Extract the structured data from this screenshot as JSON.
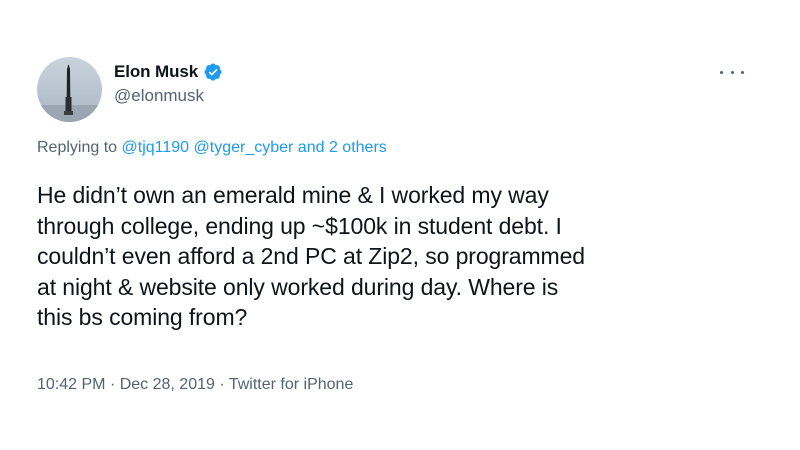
{
  "tweet": {
    "author": {
      "display_name": "Elon Musk",
      "handle": "@elonmusk",
      "avatar_icon": "rocket-avatar",
      "verified_icon": "verified-badge-icon"
    },
    "more_icon": "more-horizontal-icon",
    "replying_to": {
      "prefix": "Replying to",
      "users": [
        "@tjq1190",
        "@tyger_cyber"
      ],
      "and_text": "and",
      "others_text": "2 others"
    },
    "text": "He didn’t own an emerald mine & I worked my way\nthrough college, ending up ~$100k in student debt. I\ncouldn’t even afford a 2nd PC at Zip2, so programmed\nat night & website only worked during day. Where is\nthis bs coming from?",
    "meta": {
      "time": "10:42 PM",
      "separator": "·",
      "date": "Dec 28, 2019",
      "source": "Twitter for iPhone"
    }
  },
  "colors": {
    "text_primary": "#0f1419",
    "text_secondary": "#536471",
    "link": "#1d9bf0",
    "verified": "#1d9bf0"
  }
}
